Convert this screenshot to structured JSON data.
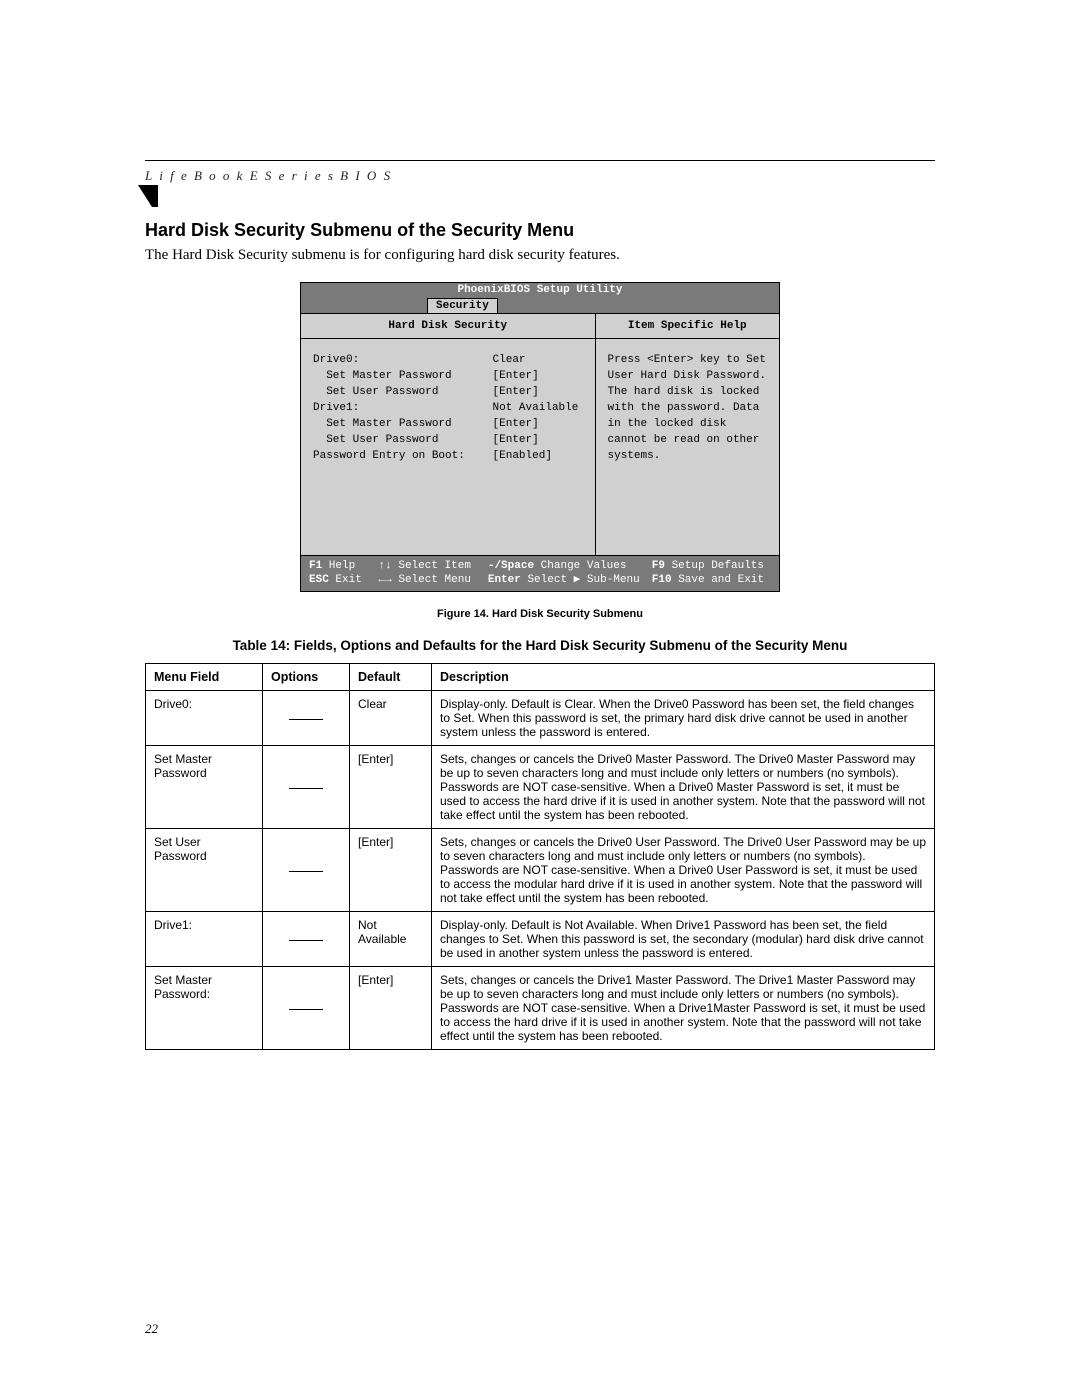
{
  "header": {
    "running_head": "L i f e B o o k   E   S e r i e s   B I O S"
  },
  "section": {
    "title": "Hard Disk Security Submenu of the Security Menu",
    "intro": "The Hard Disk Security submenu is for configuring hard disk security features."
  },
  "bios": {
    "title": "PhoenixBIOS Setup Utility",
    "tab": "Security",
    "left_header": "Hard Disk Security",
    "right_header": "Item Specific Help",
    "items": [
      {
        "label": "Drive0:",
        "value": "Clear",
        "indent": 0
      },
      {
        "label": "Set Master Password",
        "value": "[Enter]",
        "indent": 1
      },
      {
        "label": "Set User Password",
        "value": "[Enter]",
        "indent": 1
      },
      {
        "label": "Drive1:",
        "value": "Not Available",
        "indent": 0
      },
      {
        "label": "Set Master Password",
        "value": "[Enter]",
        "indent": 1
      },
      {
        "label": "Set User Password",
        "value": "[Enter]",
        "indent": 1
      },
      {
        "label": "",
        "value": "",
        "indent": 0
      },
      {
        "label": "Password Entry on Boot:",
        "value": "[Enabled]",
        "indent": 0
      }
    ],
    "help_text": "Press <Enter> key to Set User Hard Disk Password. The hard disk is locked with the password. Data in the locked disk cannot be read on other systems.",
    "footer": {
      "row1": [
        {
          "key": "F1",
          "label": " Help"
        },
        {
          "key": "↑↓",
          "label": " Select Item"
        },
        {
          "key": "-/Space",
          "label": " Change Values"
        },
        {
          "key": "F9",
          "label": " Setup Defaults"
        }
      ],
      "row2": [
        {
          "key": "ESC",
          "label": " Exit"
        },
        {
          "key": "←→",
          "label": " Select Menu"
        },
        {
          "key": "Enter",
          "label": " Select ▶ Sub-Menu"
        },
        {
          "key": "F10",
          "label": " Save and Exit"
        }
      ]
    }
  },
  "figure_caption": "Figure 14.   Hard Disk Security Submenu",
  "table_caption": "Table 14: Fields, Options and Defaults for the Hard Disk Security Submenu of the Security Menu",
  "table": {
    "headers": {
      "c1": "Menu Field",
      "c2": "Options",
      "c3": "Default",
      "c4": "Description"
    },
    "rows": [
      {
        "field": "Drive0:",
        "default": "Clear",
        "desc": "Display-only. Default is Clear. When the Drive0 Password has been set, the field changes to Set. When this password is set, the primary hard disk drive cannot be used in another system unless the password is entered."
      },
      {
        "field": "Set Master Password",
        "default": "[Enter]",
        "desc": "Sets, changes or cancels the Drive0 Master Password. The Drive0 Master Password may be up to seven characters long and must include only letters or numbers (no symbols). Passwords are NOT case-sensitive. When a Drive0 Master Password is set, it must be used to access the hard drive if it is used in another system. Note that the password will not take effect until the system has been rebooted."
      },
      {
        "field": "Set User Password",
        "default": "[Enter]",
        "desc": "Sets, changes or cancels the Drive0 User Password. The Drive0 User Password may be up to seven characters long and must include only letters or numbers (no symbols). Passwords are NOT case-sensitive. When a Drive0 User Password is set, it must be used to access the modular hard drive if it is used in another system. Note that the password will not take effect until the system has been rebooted."
      },
      {
        "field": "Drive1:",
        "default": "Not Available",
        "desc": "Display-only. Default is Not Available. When Drive1 Password has been set, the field changes to Set. When this password is set, the secondary (modular) hard disk drive cannot be used in another system unless the password is entered."
      },
      {
        "field": "Set Master Password:",
        "default": "[Enter]",
        "desc": "Sets, changes or cancels the Drive1 Master Password. The Drive1 Master Password may be up to seven characters long and must include only letters or numbers (no symbols). Passwords are NOT case-sensitive. When a Drive1Master Password is set, it must be used to access the hard drive if it is used in another system. Note that the password will not take effect until the system has been rebooted."
      }
    ]
  },
  "page_number": "22"
}
